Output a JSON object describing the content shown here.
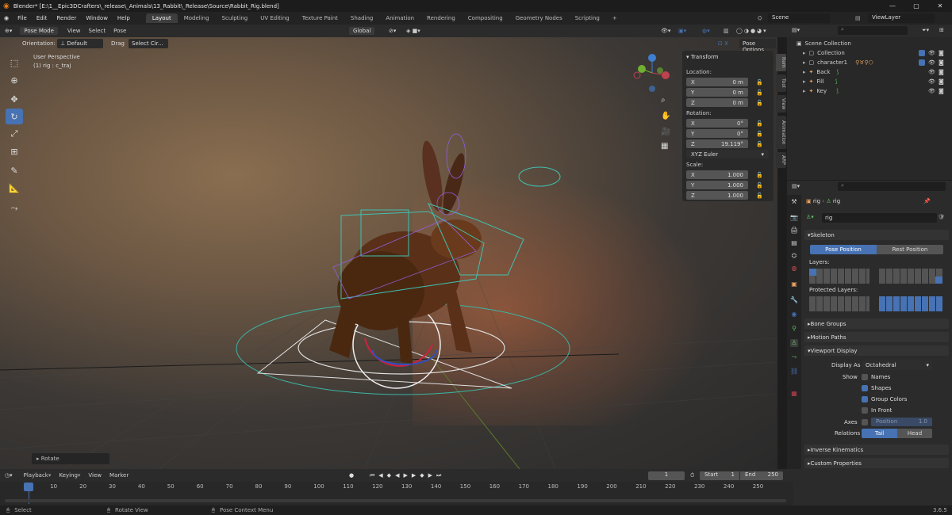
{
  "title": "Blender* [E:\\1__Epic3DCrafters\\_release\\_Animals\\13_Rabbit\\_Release\\Source\\Rabbit_Rig.blend]",
  "menu": [
    "File",
    "Edit",
    "Render",
    "Window",
    "Help"
  ],
  "workspaces": [
    "Layout",
    "Modeling",
    "Sculpting",
    "UV Editing",
    "Texture Paint",
    "Shading",
    "Animation",
    "Rendering",
    "Compositing",
    "Geometry Nodes",
    "Scripting"
  ],
  "scene": "Scene",
  "viewlayer": "ViewLayer",
  "header": {
    "mode": "Pose Mode",
    "view": "View",
    "select": "Select",
    "pose": "Pose",
    "transform": "Global"
  },
  "header2": {
    "orientation_label": "Orientation:",
    "orientation": "Default",
    "drag_label": "Drag",
    "drag": "Select Cir...",
    "pose_options": "Pose Options"
  },
  "viewport": {
    "perspective": "User Perspective",
    "object": "(1) rig : c_traj",
    "operator": "Rotate"
  },
  "npanel": {
    "title": "Transform",
    "location": "Location:",
    "loc": [
      "0 m",
      "0 m",
      "0 m"
    ],
    "rotation": "Rotation:",
    "rot": [
      "0°",
      "0°",
      "19.119°"
    ],
    "euler": "XYZ Euler",
    "scale": "Scale:",
    "scl": [
      "1.000",
      "1.000",
      "1.000"
    ],
    "axes": [
      "X",
      "Y",
      "Z"
    ]
  },
  "vtabs": [
    "Item",
    "Tool",
    "View",
    "Animation",
    "ARP"
  ],
  "outliner": {
    "root": "Scene Collection",
    "items": [
      "Collection",
      "character1",
      "Back",
      "Fill",
      "Key"
    ]
  },
  "props": {
    "object": "rig",
    "data": "rig",
    "datablock": "rig",
    "skeleton": "Skeleton",
    "pose_position": "Pose Position",
    "rest_position": "Rest Position",
    "layers": "Layers:",
    "protected": "Protected Layers:",
    "bone_groups": "Bone Groups",
    "motion_paths": "Motion Paths",
    "viewport_display": "Viewport Display",
    "display_as_label": "Display As",
    "display_as": "Octahedral",
    "show": "Show",
    "names": "Names",
    "shapes": "Shapes",
    "group_colors": "Group Colors",
    "in_front": "In Front",
    "axes": "Axes",
    "position": "Position",
    "position_val": "1.0",
    "relations": "Relations",
    "tail": "Tail",
    "head": "Head",
    "ik": "Inverse Kinematics",
    "custom": "Custom Properties"
  },
  "timeline": {
    "playback": "Playback",
    "keying": "Keying",
    "view": "View",
    "marker": "Marker",
    "frame": "1",
    "start_label": "Start",
    "start": "1",
    "end_label": "End",
    "end": "250",
    "ticks": [
      "1",
      "10",
      "20",
      "30",
      "40",
      "50",
      "60",
      "70",
      "80",
      "90",
      "100",
      "110",
      "120",
      "130",
      "140",
      "150",
      "160",
      "170",
      "180",
      "190",
      "200",
      "210",
      "220",
      "230",
      "240",
      "250"
    ]
  },
  "status": {
    "select": "Select",
    "rotate": "Rotate View",
    "context": "Pose Context Menu",
    "version": "3.6.5"
  }
}
